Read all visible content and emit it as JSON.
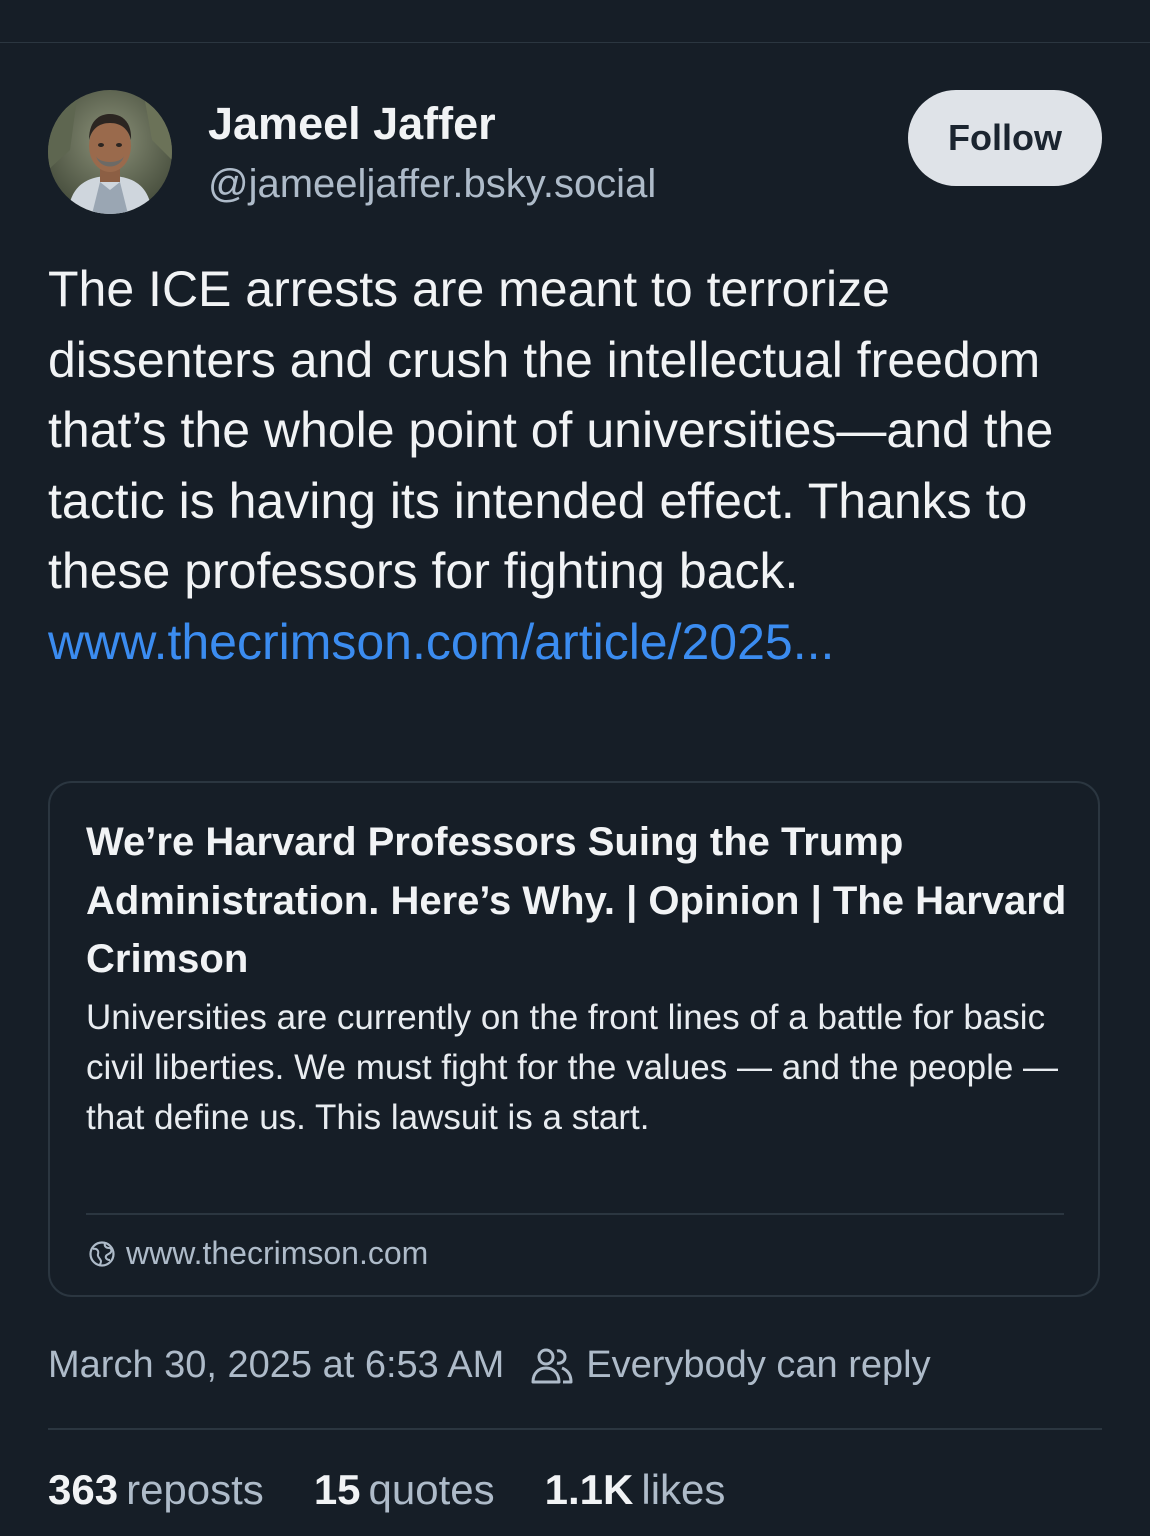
{
  "author": {
    "name": "Jameel Jaffer",
    "handle": "@jameeljaffer.bsky.social",
    "follow_label": "Follow"
  },
  "post": {
    "text": "The ICE arrests are meant to terrorize dissenters and crush the intellectual freedom that’s the whole point of universities—and the tactic is having its intended effect. Thanks to these professors for fighting back.",
    "link_text": "www.thecrimson.com/article/2025..."
  },
  "embed": {
    "title": "We’re Harvard Professors Suing the Trump Administration. Here’s Why. | Opinion | The Harvard Crimson",
    "description": "Universities are currently on the front lines of a battle for basic civil liberties. We must fight for the values — and the people — that define us. This lawsuit is a start.",
    "domain": "www.thecrimson.com"
  },
  "meta": {
    "timestamp": "March 30, 2025 at 6:53 AM",
    "reply_setting": "Everybody can reply"
  },
  "stats": {
    "reposts_count": "363",
    "reposts_label": "reposts",
    "quotes_count": "15",
    "quotes_label": "quotes",
    "likes_count": "1.1K",
    "likes_label": "likes"
  },
  "icons": {
    "globe": "globe-icon",
    "people": "people-icon"
  }
}
